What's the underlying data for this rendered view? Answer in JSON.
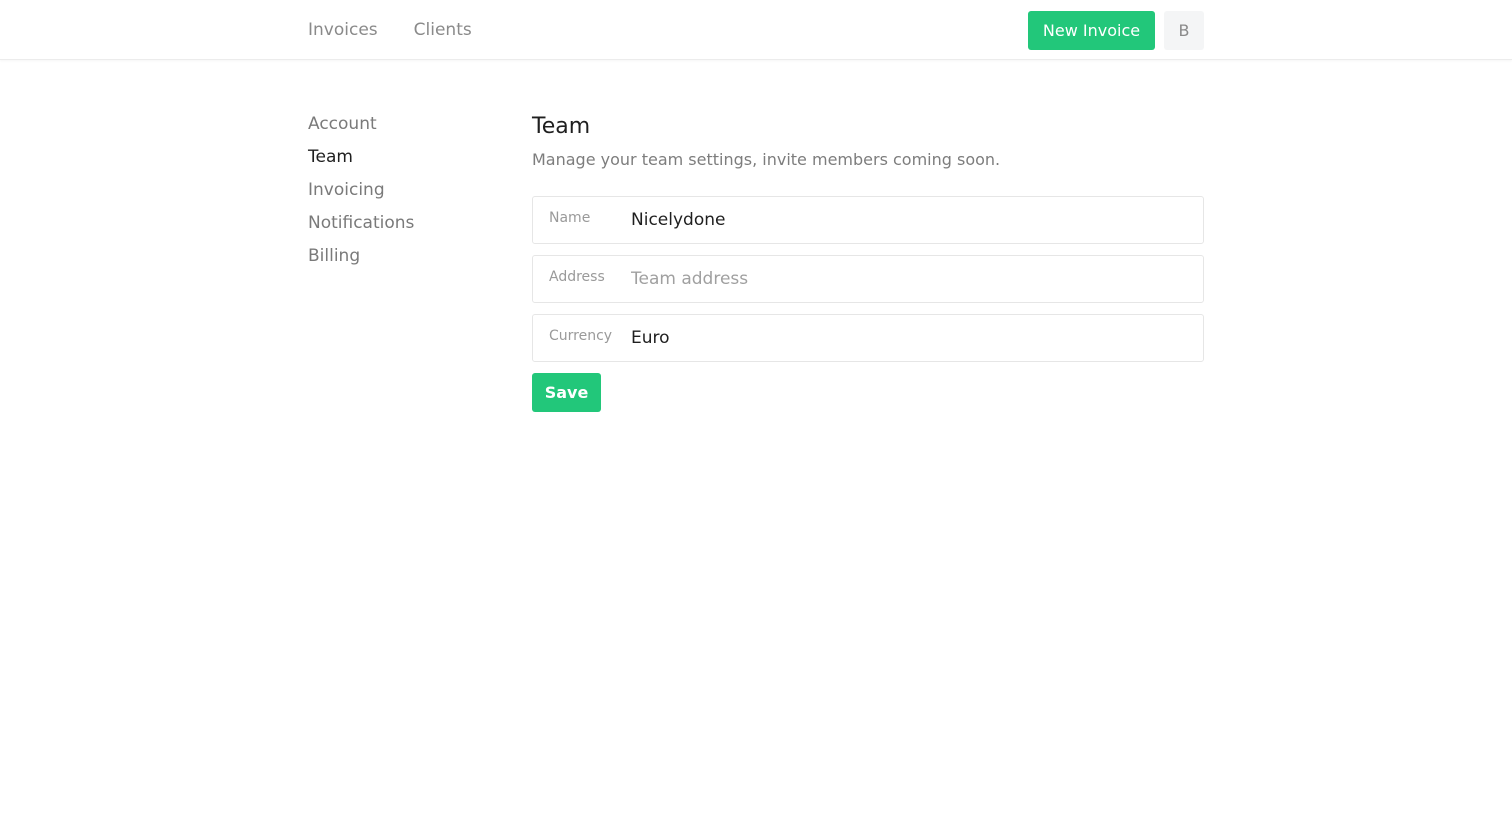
{
  "topnav": {
    "links": [
      {
        "label": "Invoices"
      },
      {
        "label": "Clients"
      }
    ],
    "new_invoice_label": "New Invoice",
    "avatar_initial": "B"
  },
  "sidebar": {
    "items": [
      {
        "label": "Account",
        "active": false
      },
      {
        "label": "Team",
        "active": true
      },
      {
        "label": "Invoicing",
        "active": false
      },
      {
        "label": "Notifications",
        "active": false
      },
      {
        "label": "Billing",
        "active": false
      }
    ]
  },
  "main": {
    "title": "Team",
    "description": "Manage your team settings, invite members coming soon.",
    "fields": [
      {
        "label": "Name",
        "value": "Nicelydone",
        "placeholder": ""
      },
      {
        "label": "Address",
        "value": "",
        "placeholder": "Team address"
      },
      {
        "label": "Currency",
        "value": "Euro",
        "placeholder": ""
      }
    ],
    "save_label": "Save"
  },
  "colors": {
    "accent": "#22c77a",
    "text_primary": "#1f1f1f",
    "text_muted": "#7d7d7d",
    "border": "#e6e6e6"
  }
}
